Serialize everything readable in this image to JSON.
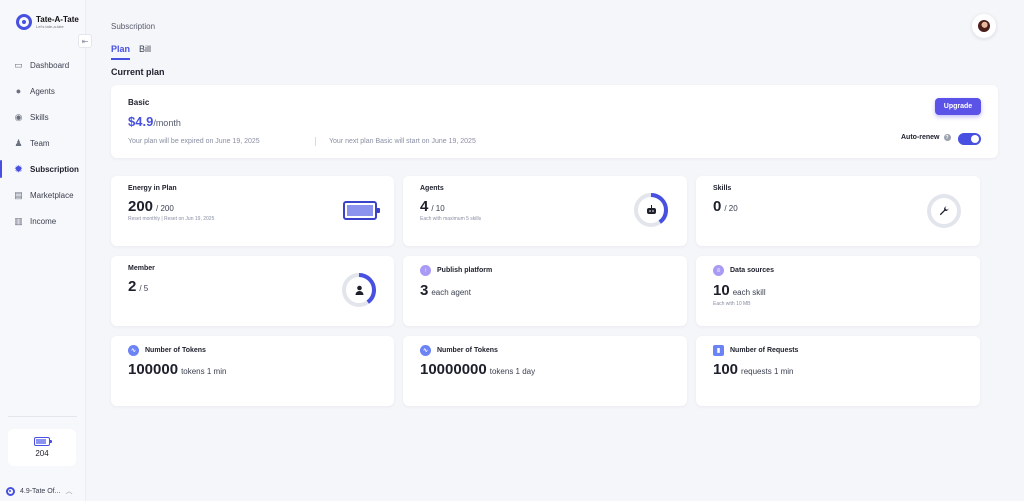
{
  "app": {
    "logo_title": "Tate-A-Tate",
    "logo_subtitle": "Let's tate-a-tate"
  },
  "sidebar": {
    "items": [
      {
        "label": "Dashboard",
        "icon": "dashboard-icon",
        "active": false
      },
      {
        "label": "Agents",
        "icon": "agents-icon",
        "active": false
      },
      {
        "label": "Skills",
        "icon": "skills-icon",
        "active": false
      },
      {
        "label": "Team",
        "icon": "team-icon",
        "active": false
      },
      {
        "label": "Subscription",
        "icon": "gear-icon",
        "active": true
      },
      {
        "label": "Marketplace",
        "icon": "marketplace-icon",
        "active": false
      },
      {
        "label": "Income",
        "icon": "income-icon",
        "active": false
      }
    ],
    "energy_value": "204",
    "energy_level": 0.8,
    "plan_switch_label": "4.9-Tate Of..."
  },
  "header": {
    "breadcrumb": "Subscription"
  },
  "tabs": [
    {
      "label": "Plan",
      "active": true
    },
    {
      "label": "Bill",
      "active": false
    }
  ],
  "section_title": "Current plan",
  "plan": {
    "name": "Basic",
    "price": "$4.9",
    "period": "/month",
    "expire_text": "Your plan will be expired on June 19, 2025",
    "next_text": "Your next plan Basic will start on June 19, 2025",
    "upgrade_label": "Upgrade",
    "autorenew_label": "Auto-renew",
    "autorenew_on": true
  },
  "stats": {
    "energy": {
      "title": "Energy in Plan",
      "value": "200",
      "total": "/ 200",
      "note": "Reset monthly | Reset on Jun 19, 2025",
      "level": 1.0
    },
    "agents": {
      "title": "Agents",
      "value": "4",
      "total": "/ 10",
      "note": "Each with maximum 5 skills",
      "fraction": 0.4
    },
    "skills": {
      "title": "Skills",
      "value": "0",
      "total": "/ 20",
      "fraction": 0.0
    },
    "member": {
      "title": "Member",
      "value": "2",
      "total": "/ 5",
      "fraction": 0.4
    },
    "publish": {
      "title": "Publish platform",
      "value": "3",
      "unit": "each agent"
    },
    "datasources": {
      "title": "Data sources",
      "value": "10",
      "unit": "each skill",
      "note": "Each with 10 MB"
    },
    "tokens1": {
      "title": "Number of Tokens",
      "value": "100000",
      "unit": "tokens 1 min"
    },
    "tokens2": {
      "title": "Number of Tokens",
      "value": "10000000",
      "unit": "tokens 1 day"
    },
    "requests": {
      "title": "Number of Requests",
      "value": "100",
      "unit": "requests 1 min"
    }
  },
  "colors": {
    "accent": "#4750e0",
    "ring_track": "#e3e5ec",
    "button": "#5b52e8"
  }
}
